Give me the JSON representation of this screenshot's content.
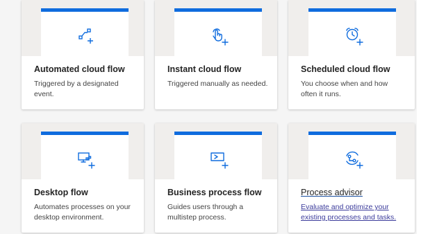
{
  "accent_color": "#0f6cde",
  "cards": [
    {
      "title": "Automated cloud flow",
      "description": "Triggered by a designated event.",
      "icon": "automated-flow-icon"
    },
    {
      "title": "Instant cloud flow",
      "description": "Triggered manually as needed.",
      "icon": "touch-hand-icon"
    },
    {
      "title": "Scheduled cloud flow",
      "description": "You choose when and how often it runs.",
      "icon": "alarm-clock-icon"
    },
    {
      "title": "Desktop flow",
      "description": "Automates processes on your desktop environment.",
      "icon": "desktop-flow-icon"
    },
    {
      "title": "Business process flow",
      "description": "Guides users through a multistep process.",
      "icon": "process-window-icon"
    },
    {
      "title": "Process advisor",
      "description": "Evaluate and optimize your existing processes and tasks.",
      "icon": "process-advisor-icon"
    }
  ]
}
